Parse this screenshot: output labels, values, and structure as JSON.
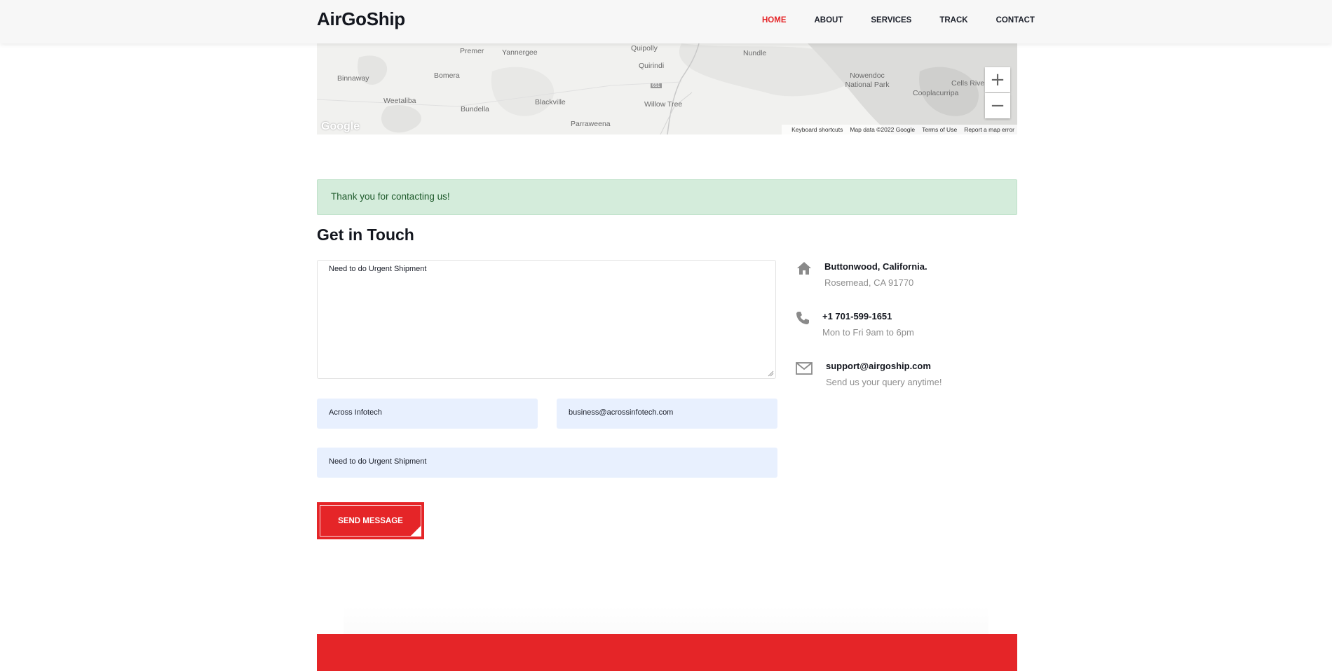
{
  "header": {
    "brand": "AirGoShip",
    "nav": [
      "HOME",
      "ABOUT",
      "SERVICES",
      "TRACK",
      "CONTACT"
    ],
    "active": "HOME"
  },
  "map": {
    "places": [
      "Premer",
      "Yannergee",
      "Quipolly",
      "Quirindi",
      "Nundle",
      "Binnaway",
      "Bomera",
      "Nowendoc National Park",
      "Cells River",
      "Cooplacurripa",
      "Weetaliba",
      "Blackville",
      "Willow Tree",
      "Bundella",
      "Parraweena",
      "651"
    ],
    "zoom_in": "+",
    "zoom_out": "−",
    "footer": [
      "Keyboard shortcuts",
      "Map data ©2022 Google",
      "Terms of Use",
      "Report a map error"
    ],
    "logo": "Google"
  },
  "alert": {
    "text": "Thank you for contacting us!"
  },
  "section_title": "Get in Touch",
  "form": {
    "message": "Need to do Urgent Shipment",
    "name": "Across Infotech",
    "email": "business@acrossinfotech.com",
    "subject": "Need to do Urgent Shipment",
    "submit": "SEND MESSAGE"
  },
  "contact": {
    "address_title": "Buttonwood, California.",
    "address_sub": "Rosemead, CA 91770",
    "phone_title": "+1 701-599-1651",
    "phone_sub": "Mon to Fri 9am to 6pm",
    "email_title": "support@airgoship.com",
    "email_sub": "Send us your query anytime!"
  },
  "colors": {
    "accent": "#e52528",
    "success_bg": "#d4ecdb",
    "input_bg": "#e8f0fe"
  }
}
